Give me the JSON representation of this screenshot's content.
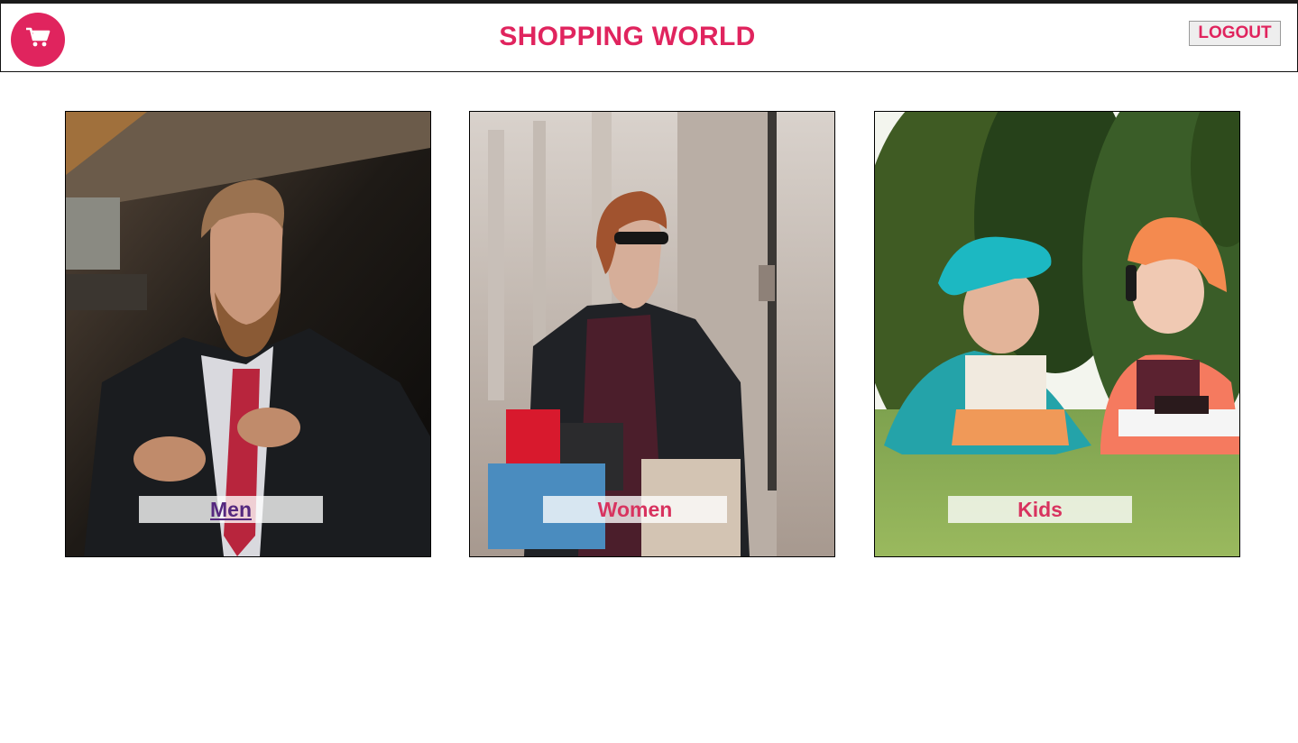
{
  "header": {
    "title": "SHOPPING WORLD",
    "logout_label": "LOGOUT",
    "logo_icon": "shopping-cart-icon"
  },
  "categories": [
    {
      "label": "Men",
      "image": "man-in-suit-photo"
    },
    {
      "label": "Women",
      "image": "woman-with-shopping-bags-photo"
    },
    {
      "label": "Kids",
      "image": "two-kids-on-grass-photo"
    }
  ],
  "colors": {
    "brand": "#e0245e",
    "visited_link": "#55287f",
    "label_bg": "rgba(255,255,255,0.78)"
  }
}
